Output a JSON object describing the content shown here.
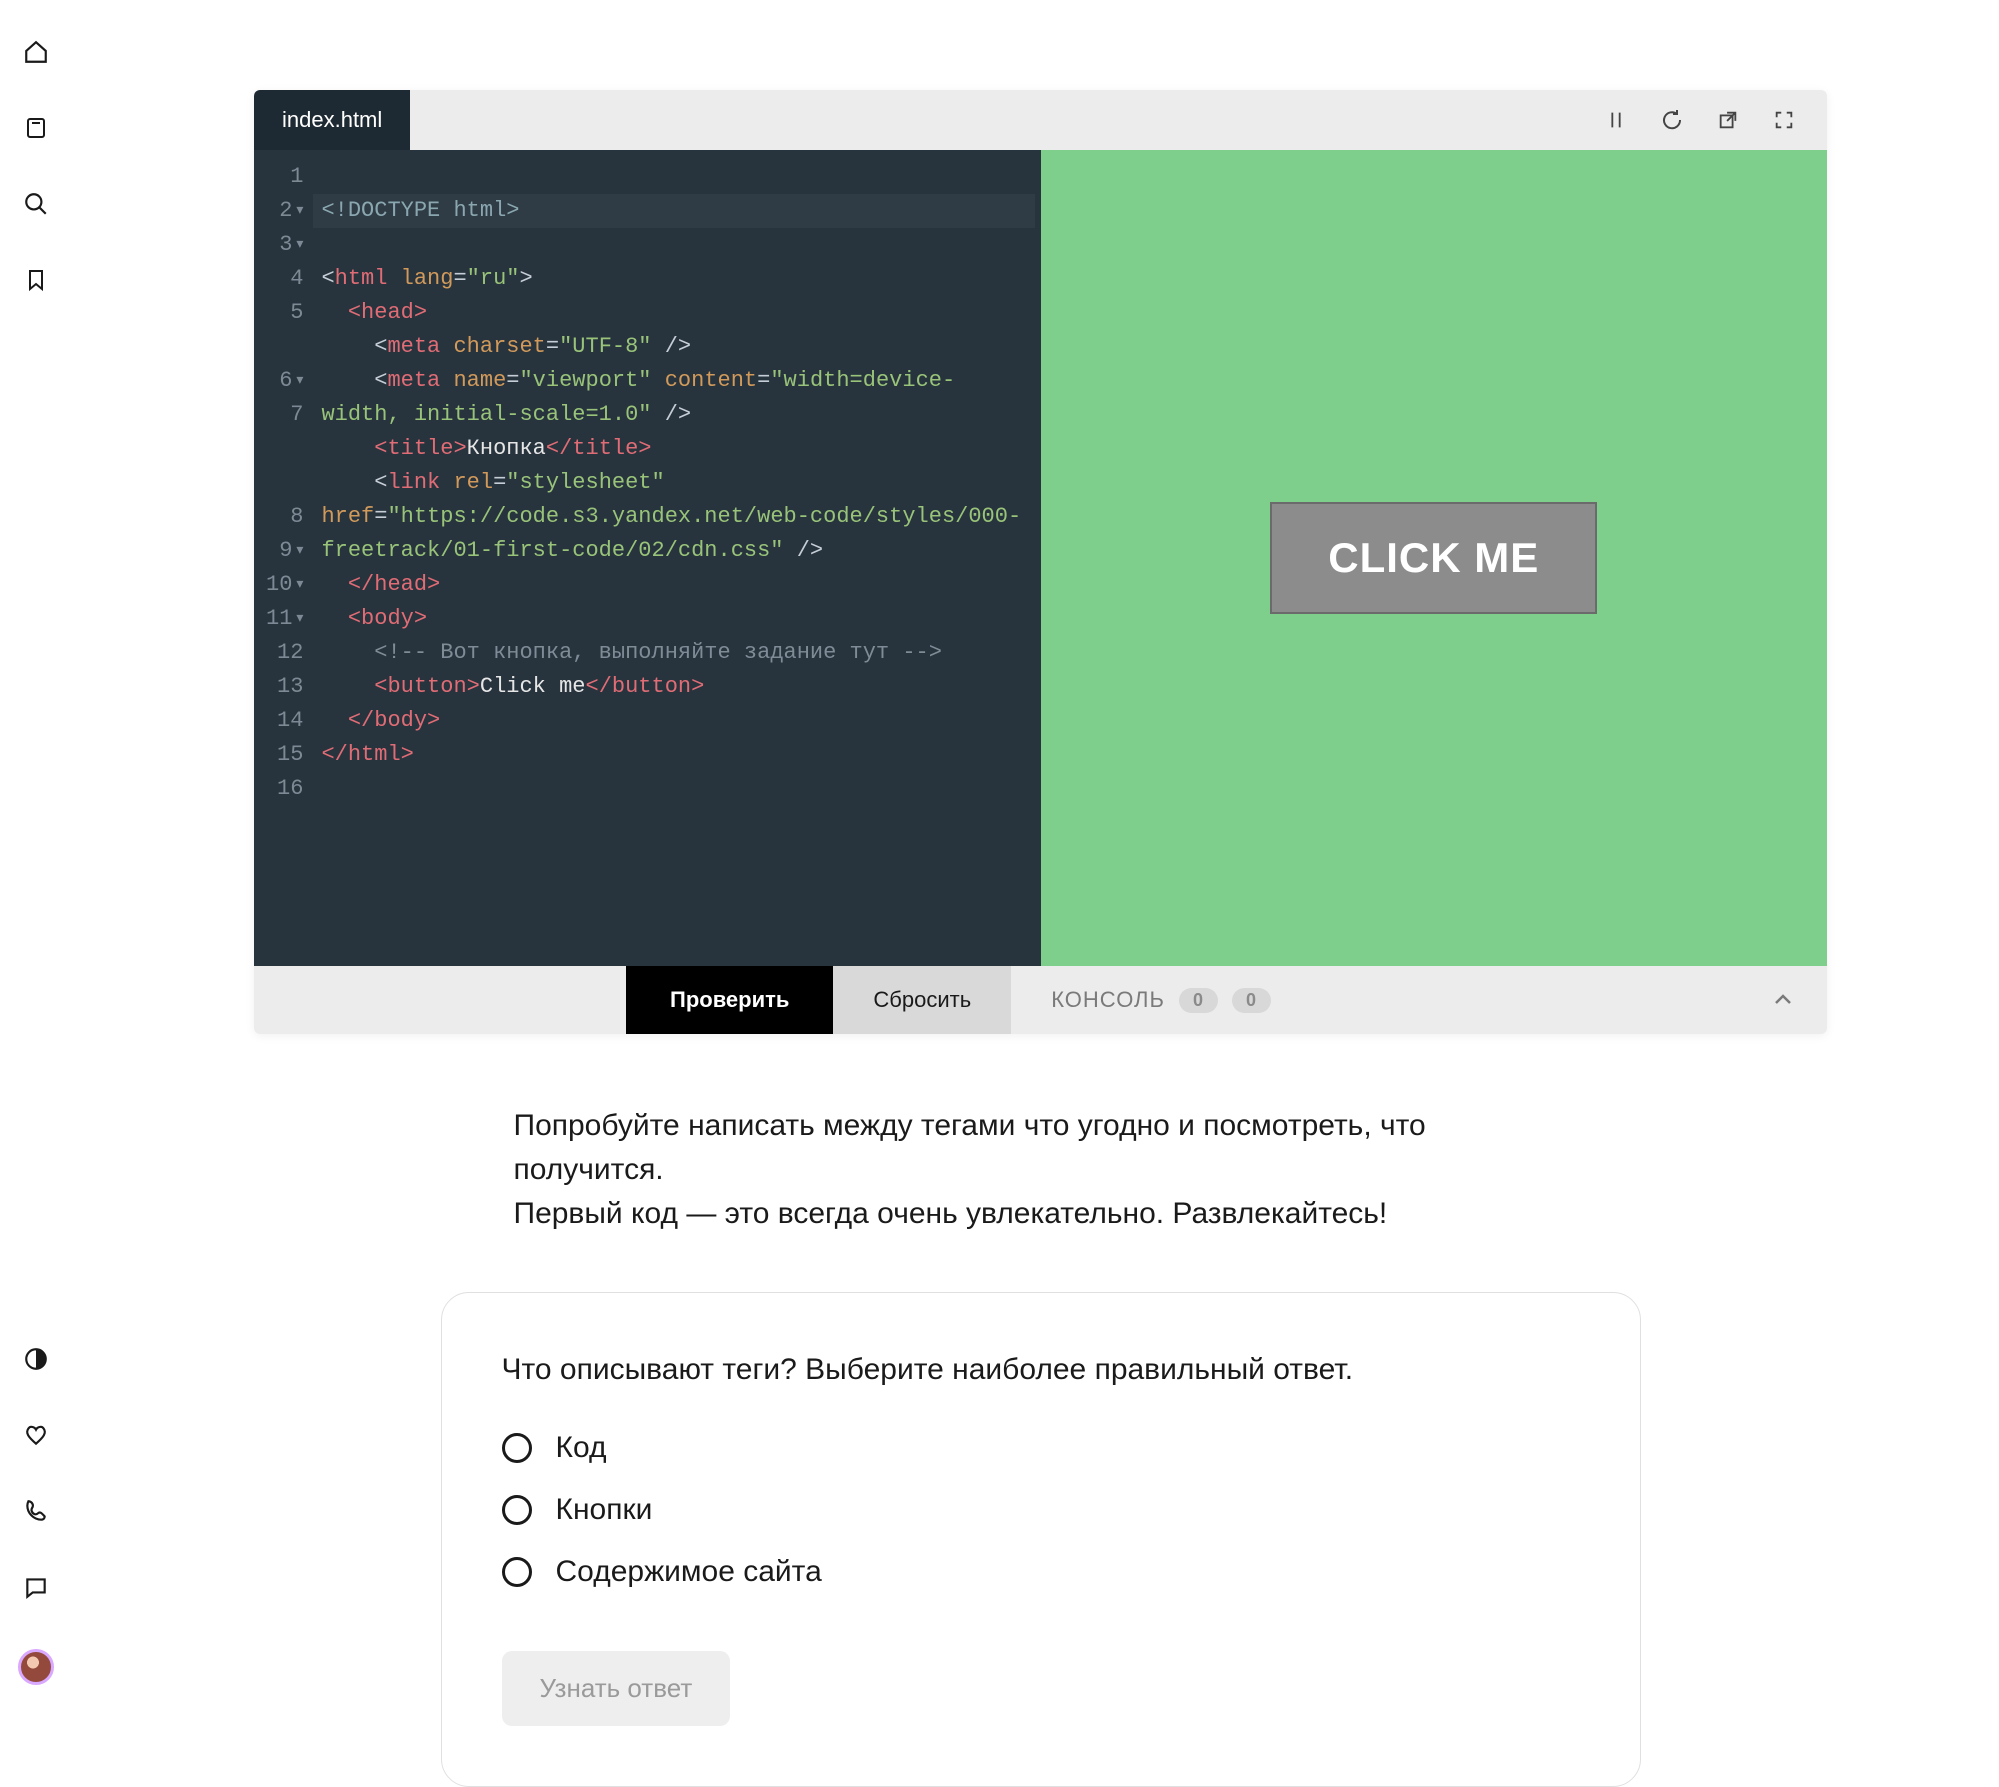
{
  "sidebar": {
    "top_icons": [
      "home-icon",
      "book-icon",
      "search-icon",
      "bookmark-icon"
    ],
    "bottom_icons": [
      "contrast-icon",
      "heart-icon",
      "phone-icon",
      "chat-icon",
      "avatar"
    ]
  },
  "editor": {
    "tab_label": "index.html",
    "toolbar_icons": [
      "pause-icon",
      "refresh-icon",
      "open-external-icon",
      "fullscreen-icon"
    ],
    "gutter_numbers": [
      "1",
      "2",
      "3",
      "4",
      "5",
      "6",
      "7",
      "8",
      "9",
      "10",
      "11",
      "12",
      "13",
      "14",
      "15",
      "16"
    ],
    "foldable_rows": [
      2,
      3,
      6,
      9,
      10,
      11
    ],
    "code": {
      "doctype": "<!DOCTYPE html>",
      "html_open": {
        "tag": "html",
        "attr": "lang",
        "val": "\"ru\"",
        "close": ">"
      },
      "head_open": "<head>",
      "meta1": {
        "tag": "meta",
        "attr1": "charset",
        "val1": "\"UTF-8\"",
        "tail": " />"
      },
      "meta2_a": {
        "tag": "meta",
        "attr1": "name",
        "val1": "\"viewport\"",
        "attr2": "content",
        "val2a": "\"width=device-"
      },
      "meta2_b": "width, initial-scale=1.0\"",
      "meta2_tail": " />",
      "title": {
        "open": "<title>",
        "text": "Кнопка",
        "close": "</title>"
      },
      "link_a": {
        "tag": "link",
        "attr1": "rel",
        "val1": "\"stylesheet\""
      },
      "link_b_attr": "href",
      "link_b_val": "\"https://code.s3.yandex.net/web-code/styles/000-",
      "link_c": "freetrack/01-first-code/02/cdn.css\"",
      "link_tail": " />",
      "head_close": "</head>",
      "body_open": "<body>",
      "comment": "<!-- Вот кнопка, выполняйте задание тут -->",
      "button": {
        "open": "<button>",
        "text": "Click me",
        "close": "</button>"
      },
      "body_close": "</body>",
      "html_close": "</html>"
    },
    "preview_button_label": "CLICK ME",
    "footer": {
      "check_label": "Проверить",
      "reset_label": "Сбросить",
      "console_label": "КОНСОЛЬ",
      "badge_a": "0",
      "badge_b": "0"
    }
  },
  "description_line1": "Попробуйте написать между тегами что угодно и посмотреть, что получится.",
  "description_line2": "Первый код — это всегда очень увлекательно. Развлекайтесь!",
  "quiz": {
    "question": "Что описывают теги? Выберите наиболее правильный ответ.",
    "options": [
      "Код",
      "Кнопки",
      "Содержимое сайта"
    ],
    "submit_label": "Узнать ответ"
  }
}
